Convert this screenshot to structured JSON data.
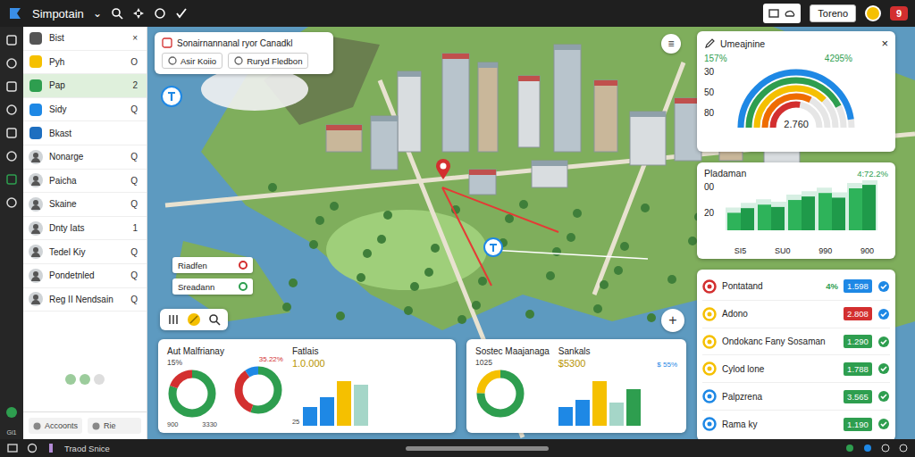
{
  "app": {
    "title": "Simpotain",
    "chevron": "⌄"
  },
  "account": {
    "label": "Toreno",
    "badge": "9"
  },
  "rail": {
    "caption": "Gi1"
  },
  "sidebar": {
    "items": [
      {
        "label": "Bist",
        "meta": "×",
        "kind": "icon",
        "color": "#555555",
        "selected": false
      },
      {
        "label": "Pyh",
        "meta": "O",
        "kind": "icon",
        "color": "#f5c000",
        "selected": false
      },
      {
        "label": "Pap",
        "meta": "2",
        "kind": "icon",
        "color": "#2e9e4f",
        "selected": true
      },
      {
        "label": "Sidy",
        "meta": "Q",
        "kind": "icon",
        "color": "#1e88e5",
        "selected": false
      },
      {
        "label": "Bkast",
        "kind": "icon",
        "color": "#1e6fc0",
        "selected": false
      },
      {
        "label": "Nonarge",
        "meta": "Q",
        "kind": "avatar",
        "selected": false
      },
      {
        "label": "Paicha",
        "meta": "Q",
        "kind": "avatar",
        "selected": false
      },
      {
        "label": "Skaine",
        "meta": "Q",
        "kind": "avatar",
        "selected": false
      },
      {
        "label": "Dnty Iats",
        "meta": "1",
        "kind": "avatar",
        "selected": false
      },
      {
        "label": "Tedel Kiy",
        "meta": "Q",
        "kind": "avatar",
        "selected": false
      },
      {
        "label": "Pondetnled",
        "meta": "Q",
        "kind": "avatar",
        "selected": false
      },
      {
        "label": "Reg II Nendsain",
        "meta": "Q",
        "kind": "avatar",
        "selected": false
      }
    ],
    "pager": [
      {
        "on": true
      },
      {
        "on": true
      },
      {
        "on": false
      }
    ],
    "footer": [
      "Accoonts",
      "Rie"
    ]
  },
  "map": {
    "card": {
      "title": "Sonairnannanal ryor Canadkl",
      "buttons": [
        "Asir Koiio",
        "Ruryd Fledbon"
      ]
    },
    "legend": [
      {
        "label": "Riadfen",
        "color": "#d32f2f"
      },
      {
        "label": "Sreadann",
        "color": "#2e9e4f"
      }
    ],
    "zoom": "+",
    "menu": "≡"
  },
  "gauge_card": {
    "title": "Umeajnine",
    "close": "×",
    "left": "157%",
    "right": "4295%",
    "ticks": [
      "30",
      "50",
      "80"
    ],
    "value": "2.760",
    "arcs": [
      {
        "color": "#1e88e5",
        "level": 0.95
      },
      {
        "color": "#2e9e4f",
        "level": 0.85
      },
      {
        "color": "#f5c000",
        "level": 0.75
      },
      {
        "color": "#ef6c00",
        "level": 0.65
      },
      {
        "color": "#d32f2f",
        "level": 0.55
      }
    ]
  },
  "trend_card": {
    "title": "Pladaman",
    "change": "4:72.2%",
    "ticks": [
      "00",
      "20"
    ],
    "labels": [
      "SI5",
      "SU0",
      "990",
      "900"
    ],
    "values": [
      30,
      38,
      44,
      40,
      52,
      58,
      64,
      56,
      72,
      78
    ]
  },
  "list_card": {
    "rows": [
      {
        "name": "Pontatand",
        "pct": "4%",
        "value": "1.598",
        "color": "#1e88e5",
        "icon_color": "#d32f2f",
        "check_color": "#1e88e5"
      },
      {
        "name": "Adono",
        "value": "2.808",
        "color": "#d32f2f",
        "icon_color": "#f5c000",
        "check_color": "#1e88e5"
      },
      {
        "name": "Ondokanc Fany Sosaman",
        "value": "1.290",
        "color": "#2e9e4f",
        "icon_color": "#f5c000",
        "check_color": "#2e9e4f"
      },
      {
        "name": "Cylod lone",
        "value": "1.788",
        "color": "#2e9e4f",
        "icon_color": "#f5c000",
        "check_color": "#2e9e4f"
      },
      {
        "name": "Palpzrena",
        "value": "3.565",
        "color": "#2e9e4f",
        "icon_color": "#1e88e5",
        "check_color": "#2e9e4f"
      },
      {
        "name": "Rama ky",
        "value": "1.190",
        "color": "#2e9e4f",
        "icon_color": "#1e88e5",
        "check_color": "#2e9e4f"
      }
    ]
  },
  "bottom_cards": [
    {
      "title": "Aut Malfrianay",
      "sub": "15%",
      "donuts": [
        {
          "segments": [
            {
              "value": 80,
              "color": "#2e9e4f"
            },
            {
              "value": 20,
              "color": "#d32f2f"
            }
          ],
          "captions": [
            "900",
            "3330"
          ]
        },
        {
          "segments": [
            {
              "value": 55,
              "color": "#2e9e4f"
            },
            {
              "value": 35,
              "color": "#d32f2f"
            },
            {
              "value": 10,
              "color": "#1e88e5"
            }
          ],
          "note": "35.22%"
        }
      ],
      "chart": {
        "title": "Fatlais",
        "value": "1.0.000",
        "tick": "25",
        "bars": [
          {
            "value": 30,
            "color": "#1e88e5"
          },
          {
            "value": 45,
            "color": "#1e88e5"
          },
          {
            "value": 70,
            "color": "#f5c000"
          },
          {
            "value": 65,
            "color": "#a5d6c8"
          }
        ]
      }
    },
    {
      "title": "Sostec Maajanaga",
      "sub": "1025",
      "donuts": [
        {
          "segments": [
            {
              "value": 75,
              "color": "#2e9e4f"
            },
            {
              "value": 25,
              "color": "#f5c000"
            }
          ]
        }
      ],
      "chart": {
        "title": "Sankals",
        "value": "$5300",
        "note": "$ 55%",
        "bars": [
          {
            "value": 35,
            "color": "#1e88e5"
          },
          {
            "value": 50,
            "color": "#1e88e5"
          },
          {
            "value": 85,
            "color": "#f5c000"
          },
          {
            "value": 45,
            "color": "#a5d6c8"
          },
          {
            "value": 70,
            "color": "#2e9e4f"
          }
        ]
      }
    }
  ],
  "status_bar": {
    "label": "Traod Snice"
  }
}
